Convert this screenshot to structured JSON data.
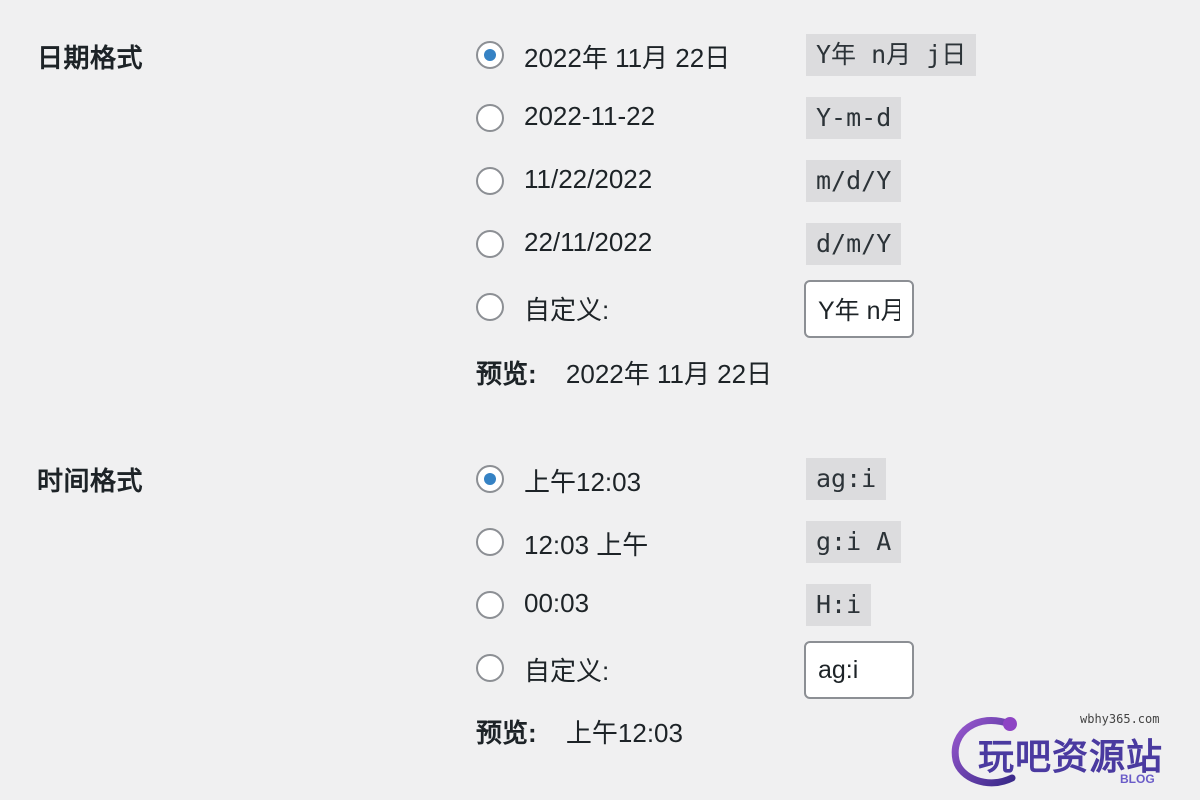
{
  "date_format": {
    "label": "日期格式",
    "options": [
      {
        "label": "2022年 11月 22日",
        "code": "Y年 n月 j日",
        "checked": true
      },
      {
        "label": "2022-11-22",
        "code": "Y-m-d",
        "checked": false
      },
      {
        "label": "11/22/2022",
        "code": "m/d/Y",
        "checked": false
      },
      {
        "label": "22/11/2022",
        "code": "d/m/Y",
        "checked": false
      }
    ],
    "custom": {
      "label": "自定义:",
      "value": "Y年 n月 j日"
    },
    "preview": {
      "label": "预览:",
      "value": "2022年 11月 22日"
    }
  },
  "time_format": {
    "label": "时间格式",
    "options": [
      {
        "label": "上午12:03",
        "code": "ag:i",
        "checked": true
      },
      {
        "label": "12:03 上午",
        "code": "g:i A",
        "checked": false
      },
      {
        "label": "00:03",
        "code": "H:i",
        "checked": false
      }
    ],
    "custom": {
      "label": "自定义:",
      "value": "ag:i"
    },
    "preview": {
      "label": "预览:",
      "value": "上午12:03"
    }
  },
  "watermark": {
    "url": "wbhy365.com",
    "title": "玩吧资源站",
    "sub": "BLOG",
    "accent": "#4a3aa0"
  }
}
